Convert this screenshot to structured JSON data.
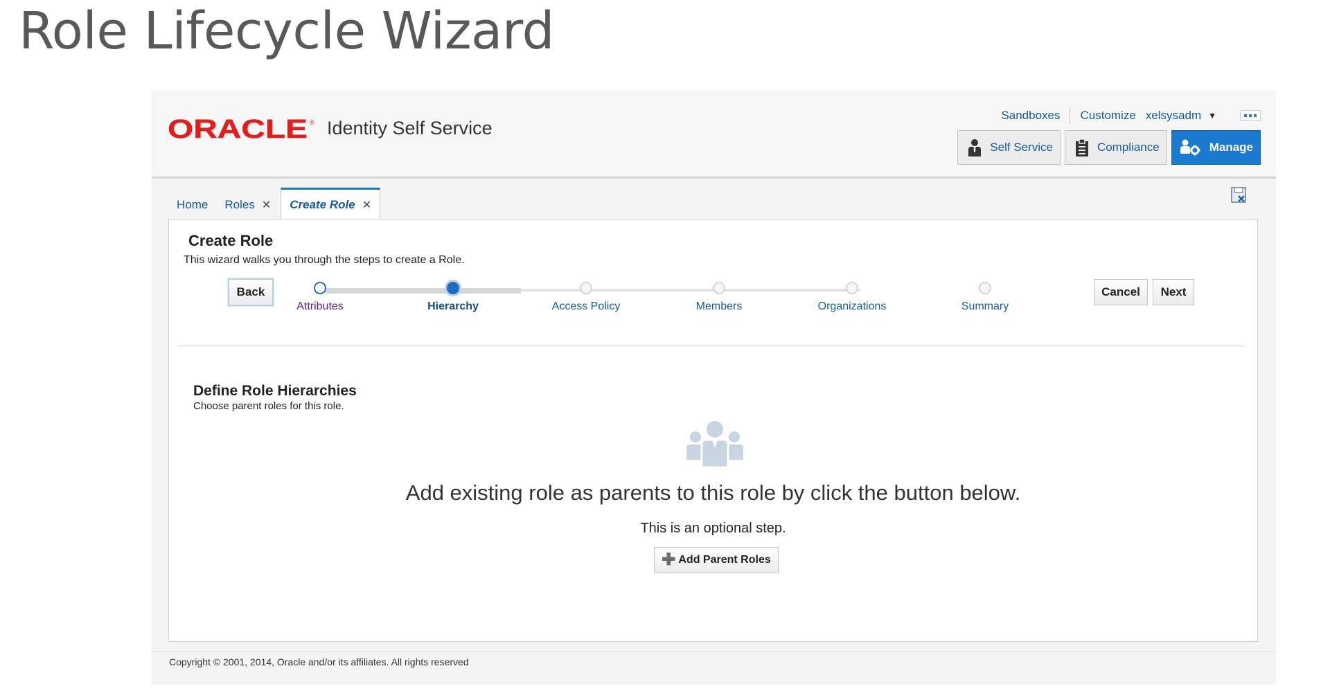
{
  "slide": {
    "title": "Role Lifecycle Wizard"
  },
  "header": {
    "brand": "ORACLE",
    "product_name": "Identity Self Service",
    "links": {
      "sandboxes": "Sandboxes",
      "customize": "Customize",
      "user": "xelsysadm"
    },
    "nav": [
      {
        "label": "Self Service",
        "icon": "person-icon",
        "active": false
      },
      {
        "label": "Compliance",
        "icon": "clipboard-icon",
        "active": false
      },
      {
        "label": "Manage",
        "icon": "users-gear-icon",
        "active": true
      }
    ]
  },
  "tabs": [
    {
      "label": "Home",
      "closable": false,
      "active": false
    },
    {
      "label": "Roles",
      "closable": true,
      "active": false
    },
    {
      "label": "Create Role",
      "closable": true,
      "active": true
    }
  ],
  "wizard": {
    "title": "Create Role",
    "description": "This wizard walks you through the steps to create a Role.",
    "back_label": "Back",
    "cancel_label": "Cancel",
    "next_label": "Next",
    "steps": [
      {
        "label": "Attributes",
        "state": "visited"
      },
      {
        "label": "Hierarchy",
        "state": "current"
      },
      {
        "label": "Access Policy",
        "state": "unvisited"
      },
      {
        "label": "Members",
        "state": "unvisited"
      },
      {
        "label": "Organizations",
        "state": "unvisited"
      },
      {
        "label": "Summary",
        "state": "unvisited"
      }
    ]
  },
  "section": {
    "title": "Define Role Hierarchies",
    "description": "Choose parent roles for this role.",
    "empty_message": "Add existing role as parents to this role by click the button below.",
    "optional_note": "This is an optional step.",
    "add_button_label": "Add Parent Roles"
  },
  "footer": {
    "copyright": "Copyright © 2001, 2014, Oracle and/or its affiliates. All rights reserved"
  },
  "colors": {
    "brand_red": "#e31c1c",
    "link_blue": "#145c9e",
    "active_blue": "#1c79d0",
    "visited_purple": "#6b1e82"
  }
}
